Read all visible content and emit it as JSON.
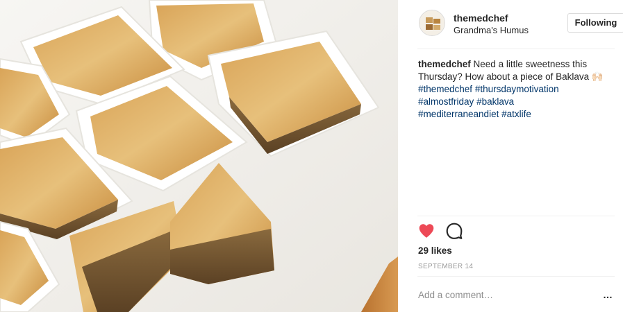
{
  "post": {
    "image_alt": "Pieces of baklava in white paper cups on a plate"
  },
  "header": {
    "username": "themedchef",
    "location": "Grandma's Humus",
    "follow_label": "Following"
  },
  "caption": {
    "username": "themedchef",
    "text": "Need a little sweetness this Thursday? How about a piece of Baklava 🙌🏻",
    "hashtags": [
      "#themedchef",
      "#thursdaymotivation",
      "#almostfriday",
      "#baklava",
      "#mediterraneandiet",
      "#atxlife"
    ]
  },
  "actions": {
    "like_icon": "heart-icon",
    "comment_icon": "comment-icon",
    "liked": true
  },
  "likes_text": "29 likes",
  "date_text": "September 14",
  "comment_box": {
    "placeholder": "Add a comment…",
    "more_icon": "…"
  },
  "colors": {
    "heart": "#ed4956",
    "hashtag": "#003569",
    "border": "#dbdbdb",
    "muted": "#999999"
  }
}
